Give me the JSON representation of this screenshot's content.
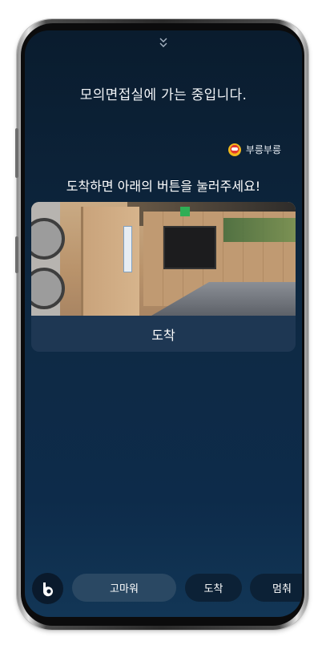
{
  "sheet": {
    "handle_icon": "double-chevron-down-icon",
    "status_text": "모의면접실에 가는 중입니다.",
    "badge": {
      "icon": "robot-icon",
      "label": "부릉부릉"
    },
    "instruction": "도착하면 아래의 버튼을 눌러주세요!",
    "card": {
      "photo": "hallway-photo",
      "button_label": "도착"
    }
  },
  "bottom_bar": {
    "assistant_icon": "bixby-icon",
    "suggestions": [
      "고마워",
      "도착",
      "멈춰"
    ]
  },
  "colors": {
    "background_top": "#0a1c2e",
    "background_bottom": "#123656",
    "card": "#1e3753",
    "chip_active": "#2a4863",
    "chip": "#0c2136"
  }
}
